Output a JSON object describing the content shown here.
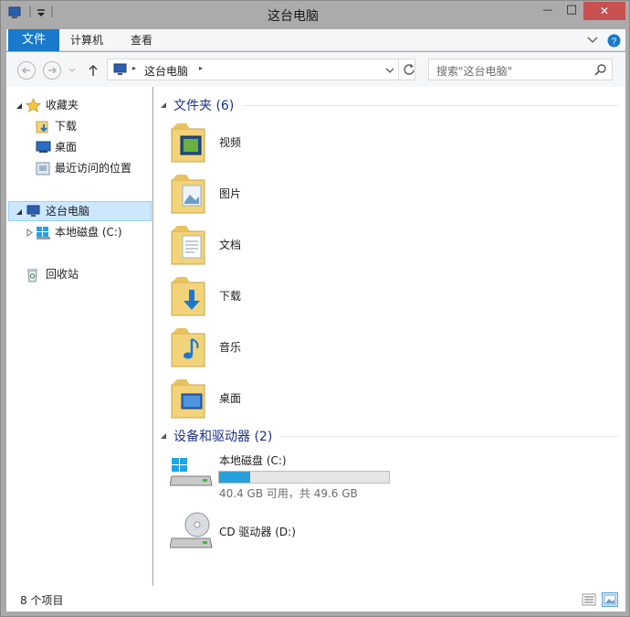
{
  "window": {
    "title": "这台电脑",
    "quick_access_sep": "|",
    "minimize_glyph": "—",
    "restore_glyph": "□",
    "close_glyph": "✕",
    "close_color": "#c75050"
  },
  "ribbon": {
    "file_tab": "文件",
    "tabs": [
      "计算机",
      "查看"
    ],
    "accent": "#1979ca",
    "expand_icon": "chevron-down",
    "help_icon": "help-question"
  },
  "navigation": {
    "back_icon": "arrow-left",
    "forward_icon": "arrow-right",
    "up_icon": "arrow-up",
    "address": {
      "separator": "▸",
      "location": "这台电脑"
    },
    "refresh_icon": "refresh",
    "search_placeholder": "搜索\"这台电脑\""
  },
  "nav_pane": {
    "favorites": {
      "label": "收藏夹",
      "items": [
        "下载",
        "桌面",
        "最近访问的位置"
      ]
    },
    "this_pc": {
      "label": "这台电脑",
      "items": [
        "本地磁盘 (C:)"
      ]
    },
    "recycle": "回收站"
  },
  "content": {
    "folders_header": "文件夹 (6)",
    "folders": [
      "视频",
      "图片",
      "文档",
      "下载",
      "音乐",
      "桌面"
    ],
    "devices_header": "设备和驱动器 (2)",
    "drives": [
      {
        "name": "本地磁盘 (C:)",
        "space": "40.4 GB 可用，共 49.6 GB",
        "used_fraction": 0.185
      },
      {
        "name": "CD 驱动器 (D:)"
      }
    ],
    "header_color": "#1e3287",
    "bar_fill_color": "#26a0da"
  },
  "status_bar": {
    "count": "8 个项目"
  }
}
